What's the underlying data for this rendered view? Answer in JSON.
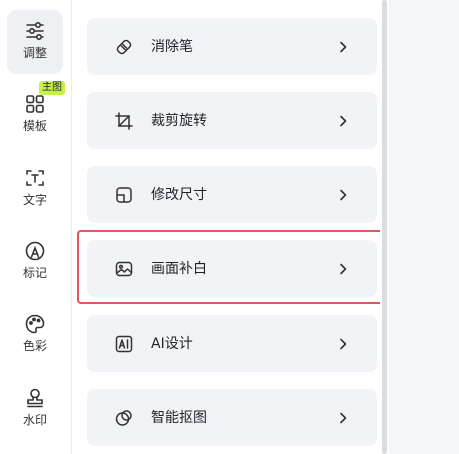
{
  "sidebar": {
    "items": [
      {
        "label": "调整",
        "icon": "sliders-icon",
        "active": true
      },
      {
        "label": "模板",
        "icon": "template-grid-icon",
        "badge": "主图"
      },
      {
        "label": "文字",
        "icon": "text-icon"
      },
      {
        "label": "标记",
        "icon": "marker-icon"
      },
      {
        "label": "色彩",
        "icon": "palette-icon"
      },
      {
        "label": "水印",
        "icon": "watermark-icon"
      }
    ]
  },
  "tools": {
    "items": [
      {
        "label": "消除笔",
        "icon": "eraser-icon"
      },
      {
        "label": "裁剪旋转",
        "icon": "crop-icon"
      },
      {
        "label": "修改尺寸",
        "icon": "resize-icon"
      },
      {
        "label": "画面补白",
        "icon": "image-fill-icon",
        "highlighted": true
      },
      {
        "label": "AI设计",
        "icon": "ai-icon"
      },
      {
        "label": "智能抠图",
        "icon": "cutout-icon"
      }
    ]
  },
  "colors": {
    "highlight_border": "#e5555f",
    "badge_bg": "#c6f04a",
    "card_bg": "#f1f3f6",
    "active_nav_bg": "#eef0f4"
  }
}
